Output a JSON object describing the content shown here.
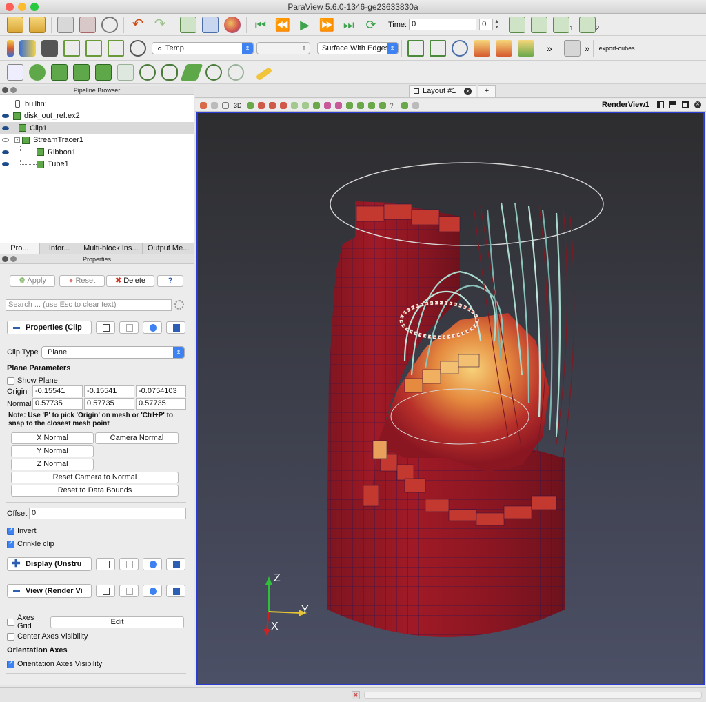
{
  "window": {
    "title": "ParaView 5.6.0-1346-ge23633830a"
  },
  "toolbar1": {
    "time_label": "Time:",
    "time_value": "0",
    "timestep_value": "0",
    "camera_labels": [
      "1",
      "2"
    ]
  },
  "toolbar2": {
    "color_by": "Temp",
    "component": "",
    "representation": "Surface With Edges",
    "overflow": "»",
    "macro": "export-cubes"
  },
  "toolbar3": {},
  "pipeline": {
    "title": "Pipeline Browser",
    "items": [
      {
        "label": "builtin:"
      },
      {
        "label": "disk_out_ref.ex2"
      },
      {
        "label": "Clip1"
      },
      {
        "label": "StreamTracer1"
      },
      {
        "label": "Ribbon1"
      },
      {
        "label": "Tube1"
      }
    ]
  },
  "tabs": [
    {
      "label": "Pro..."
    },
    {
      "label": "Infor..."
    },
    {
      "label": "Multi-block Ins..."
    },
    {
      "label": "Output Me..."
    }
  ],
  "properties": {
    "title": "Properties",
    "apply": "Apply",
    "reset": "Reset",
    "delete": "Delete",
    "help": "?",
    "search_placeholder": "Search ... (use Esc to clear text)",
    "section_properties": "Properties (Clip",
    "clip_type_label": "Clip Type",
    "clip_type_value": "Plane",
    "plane_parameters": "Plane Parameters",
    "show_plane": "Show Plane",
    "origin_label": "Origin",
    "origin": [
      "-0.15541",
      "-0.15541",
      "-0.0754103"
    ],
    "normal_label": "Normal",
    "normal": [
      "0.57735",
      "0.57735",
      "0.57735"
    ],
    "note": "Note: Use 'P' to pick 'Origin' on mesh or 'Ctrl+P' to snap to the closest mesh point",
    "x_normal": "X Normal",
    "y_normal": "Y Normal",
    "z_normal": "Z Normal",
    "camera_normal": "Camera Normal",
    "reset_camera_normal": "Reset Camera to Normal",
    "reset_data_bounds": "Reset to Data Bounds",
    "offset_label": "Offset",
    "offset_value": "0",
    "invert": "Invert",
    "crinkle": "Crinkle clip",
    "section_display": "Display (Unstru",
    "section_view": "View (Render Vi",
    "axes_grid": "Axes Grid",
    "edit": "Edit",
    "center_axes": "Center Axes Visibility",
    "orientation_axes_header": "Orientation Axes",
    "orientation_axes_vis": "Orientation Axes Visibility"
  },
  "layout": {
    "tab_label": "Layout #1",
    "add_tab": "+",
    "view_3d": "3D",
    "render_view": "RenderView1"
  },
  "axes": {
    "x": "X",
    "y": "Y",
    "z": "Z"
  },
  "colors": {
    "accent_blue": "#3d82f0",
    "bg_top": "#2c2c2e",
    "bg_bottom": "#4b5064",
    "mesh_red": "#9a1a26",
    "mesh_hot": "#f2b45a"
  }
}
